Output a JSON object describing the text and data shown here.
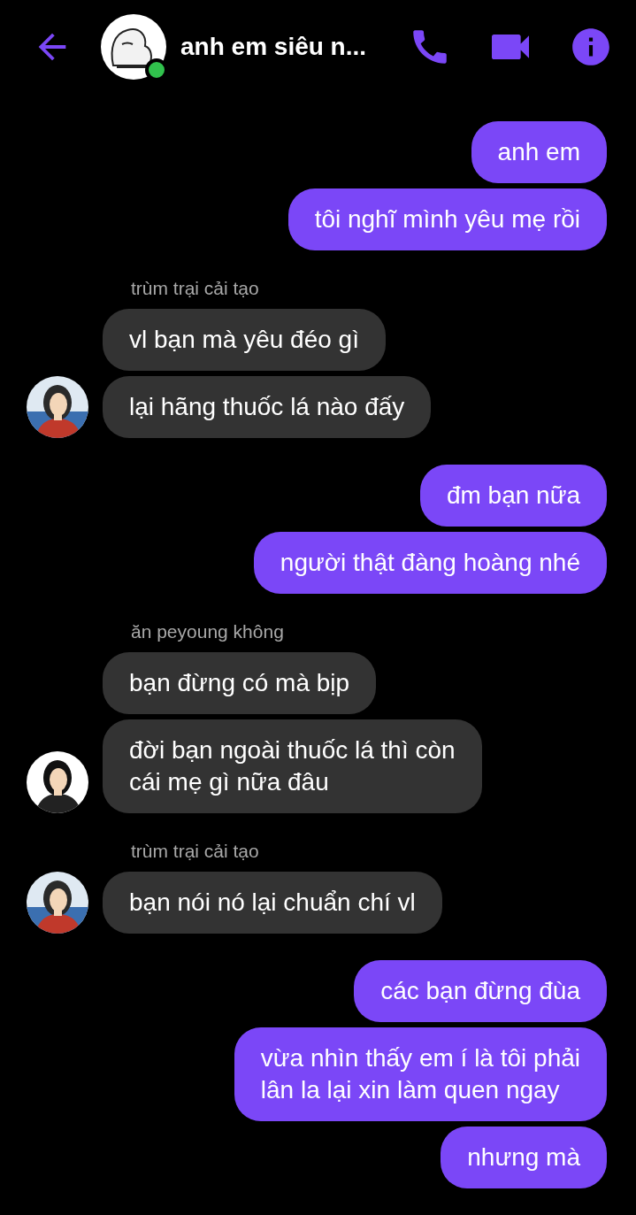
{
  "header": {
    "title": "anh em siêu n...",
    "online": true
  },
  "groups": [
    {
      "kind": "outgoing",
      "bubbles": [
        "anh em",
        "tôi nghĩ mình yêu mẹ rồi"
      ]
    },
    {
      "kind": "incoming",
      "sender": "trùm trại cải tạo",
      "bubbles": [
        "vl bạn mà yêu đéo gì",
        "lại hãng thuốc lá nào đấy"
      ]
    },
    {
      "kind": "outgoing",
      "bubbles": [
        "đm bạn nữa",
        "người thật đàng hoàng nhé"
      ]
    },
    {
      "kind": "incoming",
      "sender": "ăn peyoung không",
      "bubbles": [
        "bạn đừng có mà bịp",
        "đời bạn ngoài thuốc lá thì còn\ncái mẹ gì nữa đâu"
      ]
    },
    {
      "kind": "incoming",
      "sender": "trùm trại cải tạo",
      "bubbles": [
        "bạn nói nó lại chuẩn chí vl"
      ]
    },
    {
      "kind": "outgoing",
      "bubbles": [
        "các bạn đừng đùa",
        "vừa nhìn thấy em í là tôi phải\nlân la lại xin làm quen ngay",
        "nhưng mà"
      ]
    }
  ]
}
